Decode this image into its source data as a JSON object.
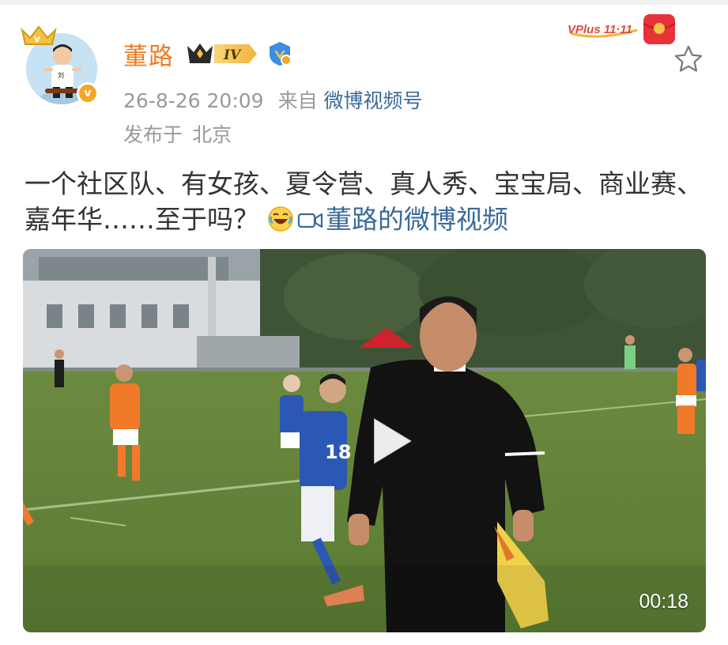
{
  "post": {
    "author": "董路",
    "level_badge": "IV",
    "timestamp": "26-8-26 20:09",
    "source_prefix": "来自",
    "source": "微博视频号",
    "location_prefix": "发布于",
    "location": "北京",
    "text": "一个社区队、有女孩、夏令营、真人秀、宝宝局、商业赛、嘉年华……至于吗？",
    "video_link": "董路的微博视频"
  },
  "promo": {
    "label": "VPlus 11·11"
  },
  "video": {
    "duration": "00:18",
    "jersey_number": "18"
  },
  "icons": {
    "avatar_badge": "v-badge-icon",
    "crown": "crown-icon",
    "verified": "verified-icon",
    "favorite": "star-icon",
    "emoji": "laughing-emoji-icon",
    "video_link": "video-camera-icon",
    "play": "play-icon"
  },
  "colors": {
    "username": "#f07b1d",
    "link": "#3a6a9a",
    "meta": "#999999",
    "body_text": "#333333",
    "badge_gold": "#f5a623"
  }
}
